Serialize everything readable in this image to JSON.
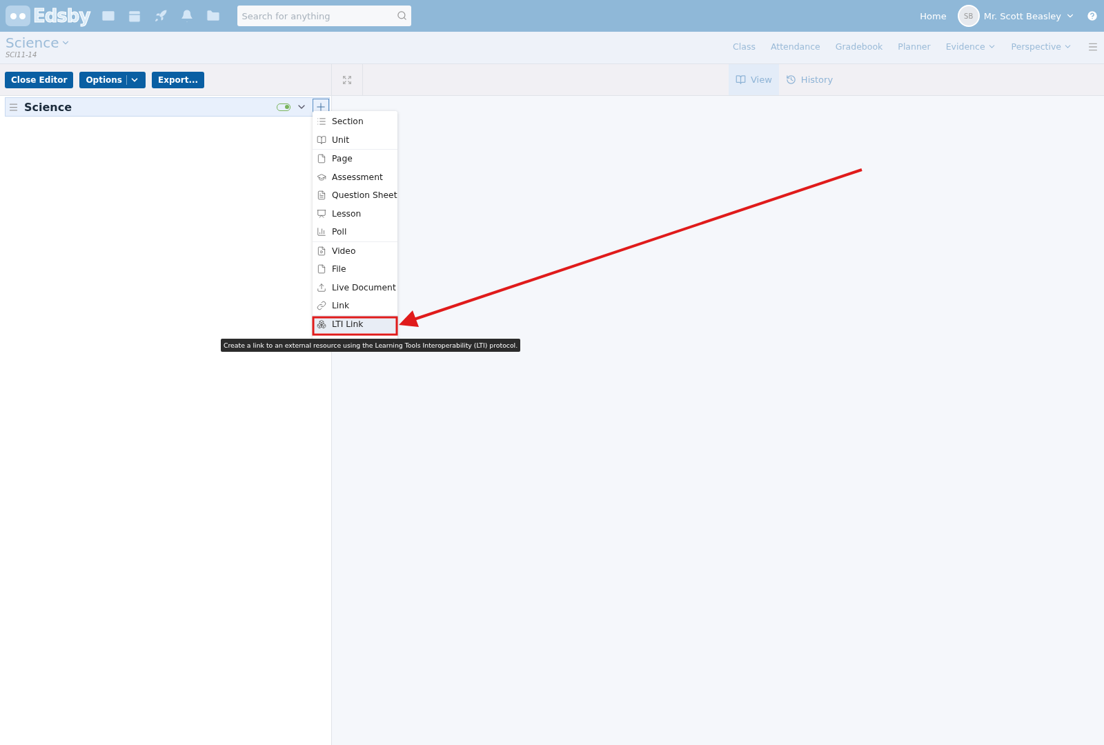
{
  "topbar": {
    "logo": "Edsby",
    "search": {
      "placeholder": "Search for anything"
    },
    "home": "Home",
    "avatar": "SB",
    "user": "Mr. Scott Beasley"
  },
  "class_header": {
    "title": "Science",
    "code": "SCI11-14",
    "nav": [
      {
        "label": "Class",
        "dropdown": false
      },
      {
        "label": "Attendance",
        "dropdown": false
      },
      {
        "label": "Gradebook",
        "dropdown": false
      },
      {
        "label": "Planner",
        "dropdown": false
      },
      {
        "label": "Evidence",
        "dropdown": true
      },
      {
        "label": "Perspective",
        "dropdown": true
      }
    ]
  },
  "toolbar": {
    "buttons": [
      "Close Editor",
      "Options",
      "Export..."
    ],
    "view_tabs": [
      {
        "label": "View",
        "selected": true
      },
      {
        "label": "History",
        "selected": false
      }
    ]
  },
  "outline": {
    "title": "Science",
    "visible": true
  },
  "add_menu": {
    "groups": [
      [
        {
          "label": "Section",
          "selected": false
        },
        {
          "label": "Unit",
          "selected": false
        }
      ],
      [
        {
          "label": "Page",
          "selected": false
        },
        {
          "label": "Assessment",
          "selected": false
        },
        {
          "label": "Question Sheet",
          "selected": false
        },
        {
          "label": "Lesson",
          "selected": false
        },
        {
          "label": "Poll",
          "selected": false
        }
      ],
      [
        {
          "label": "Video",
          "selected": false
        },
        {
          "label": "File",
          "selected": false
        },
        {
          "label": "Live Document",
          "selected": false
        },
        {
          "label": "Link",
          "selected": false
        },
        {
          "label": "LTI Link",
          "selected": true
        }
      ]
    ]
  },
  "tooltip": "Create a link to an external resource using the Learning Tools Interoperability (LTI) protocol."
}
